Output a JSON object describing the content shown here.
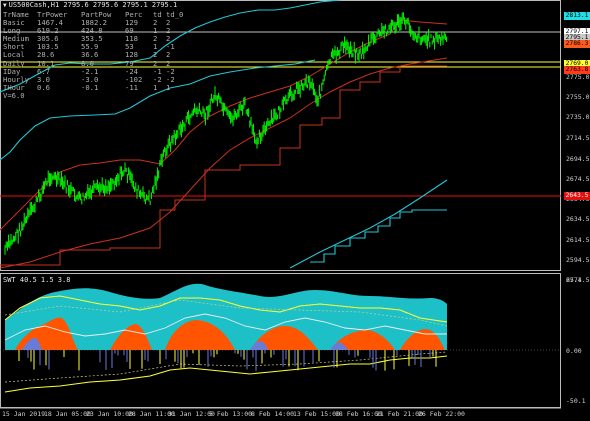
{
  "window": {
    "symbol_line": "US500Cash,H1  2795.6 2795.6 2795.1 2795.1"
  },
  "table": {
    "headers": [
      "TrName",
      "TrPower",
      "PartPow",
      "Perc",
      "td",
      "td_0"
    ],
    "rows": [
      [
        "Basic",
        "1467.4",
        "1882.2",
        "129",
        "2",
        "2"
      ],
      [
        "Long",
        "619.2",
        "424.8",
        "69",
        "1",
        "2"
      ],
      [
        "Medium",
        "305.6",
        "353.5",
        "118",
        "2",
        "2"
      ],
      [
        "Short",
        "103.5",
        "55.9",
        "53",
        "1",
        "-1"
      ],
      [
        "Local",
        "28.6",
        "36.6",
        "128",
        "2",
        "2"
      ],
      [
        "Daily",
        "10.1",
        "8.0",
        "79",
        "2",
        "2"
      ],
      [
        "IDay",
        "6.7",
        "-2.1",
        "-24",
        "-1",
        "-2"
      ],
      [
        "Hourly",
        "3.0",
        "-3.0",
        "-102",
        "-2",
        "-2"
      ],
      [
        "IHour",
        "0.6",
        "-0.1",
        "-11",
        "1",
        "1"
      ]
    ],
    "v_label": "V=6.0"
  },
  "price_tags": [
    {
      "text": "2813.1",
      "color": "#1fe0e6",
      "fg": "#000"
    },
    {
      "text": "2797.1",
      "color": "#ffffff",
      "fg": "#000"
    },
    {
      "text": "2795.1",
      "color": "#c8c8c8",
      "fg": "#000"
    },
    {
      "text": "2786.3",
      "color": "#ff5a1e",
      "fg": "#000"
    },
    {
      "text": "2769.0",
      "color": "#ffff33",
      "fg": "#000"
    },
    {
      "text": "2763.8",
      "color": "#ff3b1b",
      "fg": "#000"
    },
    {
      "text": "2643.5",
      "color": "#e31010",
      "fg": "#fff"
    }
  ],
  "price_axis": [
    "2775.0",
    "2755.0",
    "2735.0",
    "2714.5",
    "2694.5",
    "2674.5",
    "2654.5",
    "2634.5",
    "2614.5",
    "2594.5",
    "2574.5"
  ],
  "indicator": {
    "title": "SWT 40.5 1.5 3.8",
    "axis": [
      "67.1",
      "0.00",
      "-50.1"
    ]
  },
  "time_axis": [
    "15 Jan 2019",
    "18 Jan 05:00",
    "23 Jan 10:00",
    "28 Jan 11:00",
    "31 Jan 12:00",
    "5 Feb 13:00",
    "8 Feb 14:00",
    "13 Feb 15:00",
    "18 Feb 16:00",
    "21 Feb 21:00",
    "26 Feb 22:00"
  ],
  "colors": {
    "candles": "#00ff00",
    "cyan": "#1fc8d6",
    "red": "#d23c1e",
    "yellow": "#ffff33",
    "orange": "#ff5500",
    "blue": "#6a7ad8"
  }
}
